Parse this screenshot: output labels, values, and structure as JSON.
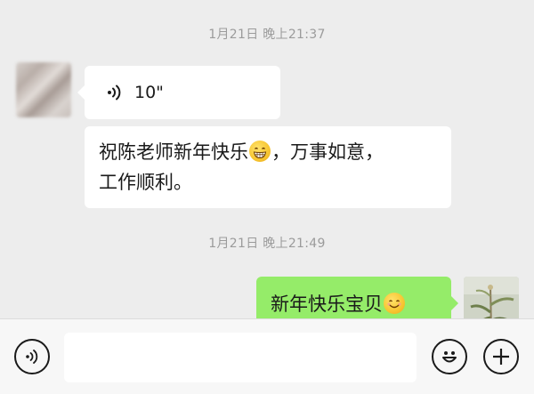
{
  "messages": {
    "timestamp1": "1月21日 晚上21:37",
    "voice_duration": "10\"",
    "text_part1": "祝陈老师新年快乐",
    "text_part2": "，万事如意，",
    "text_line2": "工作顺利。",
    "timestamp2": "1月21日 晚上21:49",
    "my_message": "新年快乐宝贝"
  },
  "input_bar": {
    "placeholder": ""
  },
  "colors": {
    "chat_background": "#ededed",
    "incoming_bubble": "#ffffff",
    "outgoing_bubble": "#95ec69",
    "timestamp_text": "#9b9b9b"
  },
  "icons": [
    "voice-wave-icon",
    "grin-emoji",
    "smile-emoji",
    "voice-toggle-icon",
    "emoji-face-icon",
    "plus-icon"
  ]
}
